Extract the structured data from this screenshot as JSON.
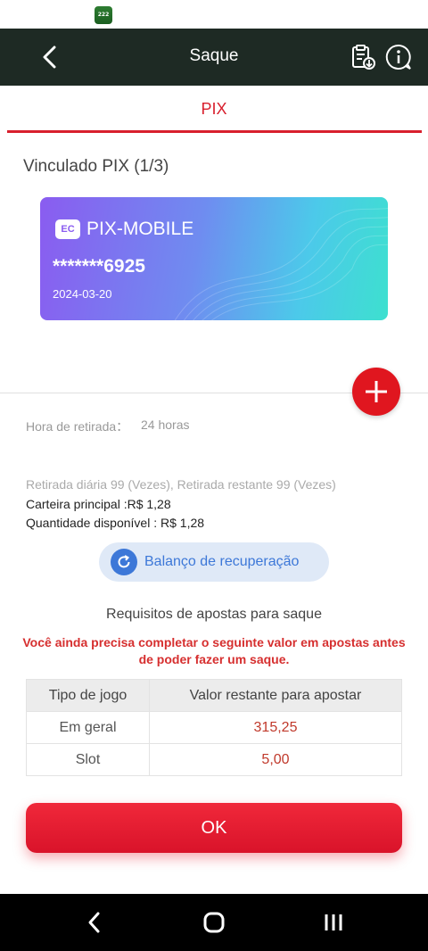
{
  "status_bar": {
    "app_icon": "app-logo-icon",
    "app_icon_text": "222"
  },
  "header": {
    "title": "Saque",
    "icons": {
      "back": "back-arrow-icon",
      "records": "clipboard-download-icon",
      "info": "info-bubble-icon"
    }
  },
  "tabs": [
    {
      "label": "PIX",
      "active": true
    }
  ],
  "section": {
    "title": "Vinculado PIX (1/3)"
  },
  "card": {
    "name": "PIX-MOBILE",
    "number": "*******6925",
    "date": "2024-03-20",
    "logo_text": "EC"
  },
  "info": {
    "hora_label": "Hora de retirada：",
    "hora_value": "24 horas",
    "retirada": "Retirada diária 99 (Vezes), Retirada restante 99 (Vezes)",
    "carteira": "Carteira principal :R$ 1,28",
    "quantidade": "Quantidade disponível : R$ 1,28"
  },
  "recover_button": {
    "label": "Balanço de recuperação"
  },
  "requirements": {
    "title": "Requisitos de apostas para saque",
    "warning": "Você ainda precisa completar o seguinte valor em apostas antes de poder fazer um saque.",
    "columns": [
      "Tipo de jogo",
      "Valor restante para apostar"
    ],
    "rows": [
      {
        "game": "Em geral",
        "value": "315,25"
      },
      {
        "game": "Slot",
        "value": "5,00"
      }
    ]
  },
  "ok_button": {
    "label": "OK"
  },
  "colors": {
    "accent": "#d81f2d",
    "header_bg": "#1e2a24",
    "link_blue": "#3d78d8"
  }
}
